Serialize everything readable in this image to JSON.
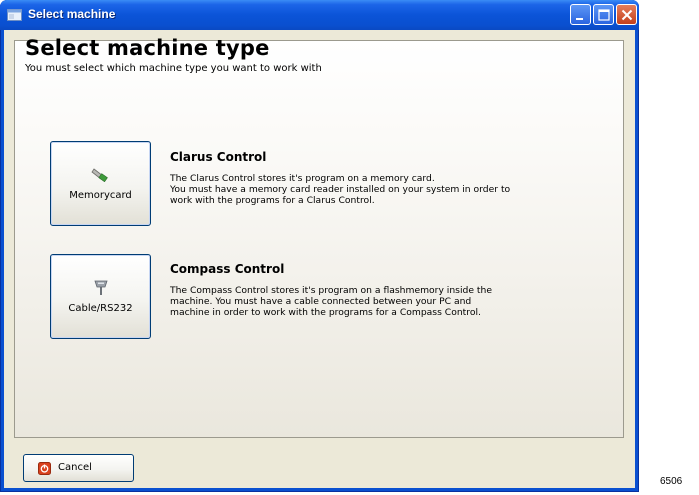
{
  "window": {
    "title": "Select machine",
    "title_icon": "app-window-icon"
  },
  "titlebar_buttons": {
    "minimize_icon": "minimize-icon",
    "maximize_icon": "maximize-icon",
    "close_icon": "close-icon"
  },
  "main": {
    "heading": "Select machine type",
    "subheading": "You must select which machine type you want to work with"
  },
  "options": [
    {
      "button_label": "Memorycard",
      "button_icon": "memory-card-icon",
      "title": "Clarus Control",
      "description_lines": [
        "The Clarus Control stores it's program on a memory card.",
        "You must have a memory card reader installed on your system in order to",
        "work with the programs for a Clarus Control."
      ]
    },
    {
      "button_label": "Cable/RS232",
      "button_icon": "serial-cable-icon",
      "title": "Compass Control",
      "description_lines": [
        "The Compass Control stores it's program on a flashmemory inside the",
        "machine. You must have a cable connected between your PC and",
        "machine in order to work with the programs for a Compass Control."
      ]
    }
  ],
  "footer": {
    "cancel_label": "Cancel",
    "cancel_icon": "cancel-icon"
  },
  "figure_code": "6506",
  "colors": {
    "titlebar": "#0a54d8",
    "client_bg": "#ece9d8",
    "close_button": "#c4401c",
    "cancel_icon": "#d9411d"
  }
}
